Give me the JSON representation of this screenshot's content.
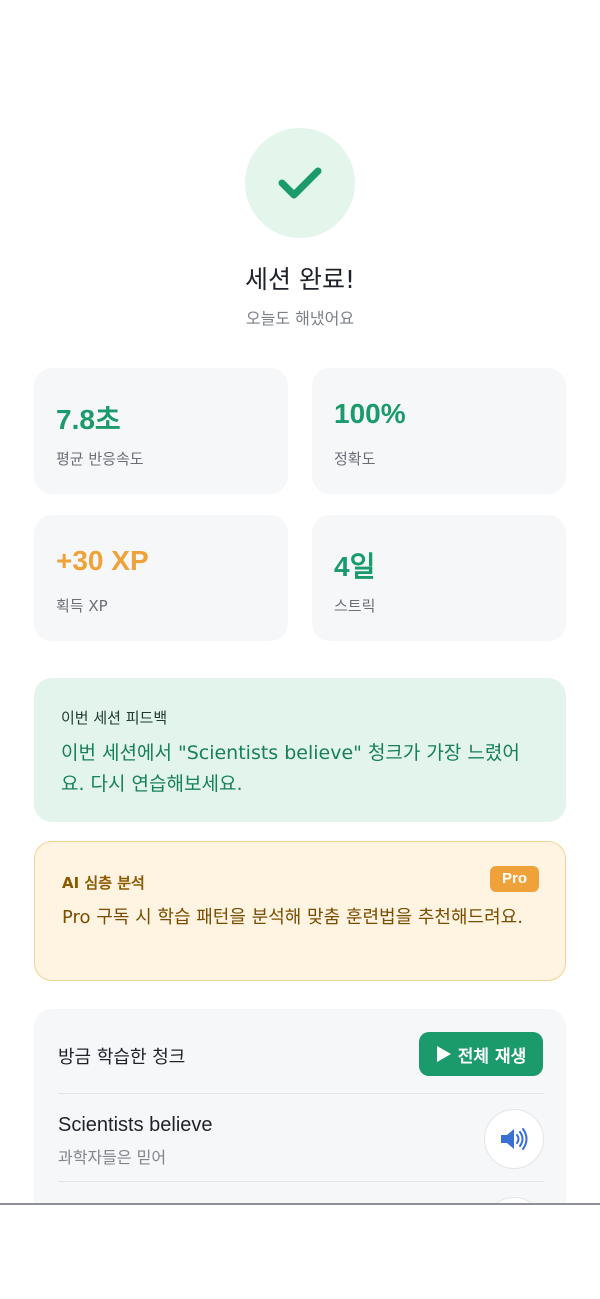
{
  "header": {
    "check_icon": "check-icon",
    "title": "세션 완료!",
    "subtitle": "오늘도 해냈어요"
  },
  "stats": [
    {
      "value": "7.8초",
      "label": "평균 반응속도",
      "color": "#1b9a6b"
    },
    {
      "value": "100%",
      "label": "정확도",
      "color": "#1b9a6b"
    },
    {
      "value": "+30 XP",
      "label": "획득 XP",
      "color": "#f0a23a"
    },
    {
      "value": "4일",
      "label": "스트릭",
      "color": "#1b9a6b"
    }
  ],
  "feedback": {
    "title": "이번 세션 피드백",
    "text": "이번 세션에서 \"Scientists believe\" 청크가 가장 느렸어요. 다시 연습해보세요."
  },
  "ai_analysis": {
    "title": "AI 심층 분석",
    "badge": "Pro",
    "text": "Pro 구독 시 학습 패턴을 분석해 맞춤 훈련법을 추천해드려요."
  },
  "chunks": {
    "header": "방금 학습한 청크",
    "play_all_label": "전체 재생",
    "play_icon": "play-icon",
    "speaker_icon": "speaker-icon",
    "items": [
      {
        "en": "Scientists believe",
        "ko": "과학자들은 믿어"
      }
    ]
  },
  "colors": {
    "accent_green": "#1b9a6b",
    "accent_orange": "#f0a23a",
    "feedback_bg": "#e3f4ec",
    "ai_bg": "#fff4e2"
  }
}
